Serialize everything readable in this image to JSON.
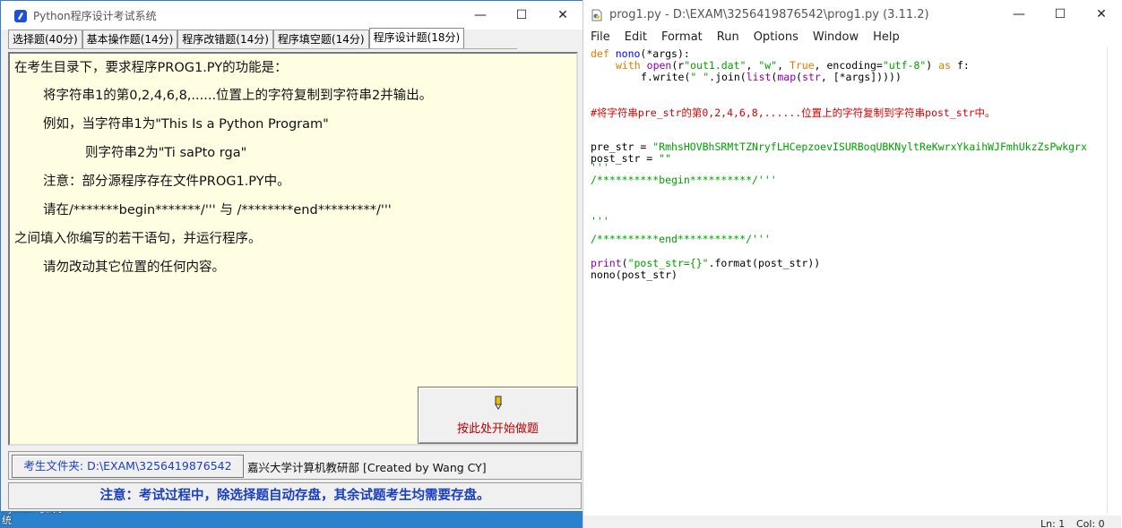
{
  "desktop": {
    "icon_label": "Python考试系统"
  },
  "exam_window": {
    "title": "Python程序设计考试系统",
    "tabs": [
      "选择题(40分)",
      "基本操作题(14分)",
      "程序改错题(14分)",
      "程序填空题(14分)",
      "程序设计题(18分)"
    ],
    "active_tab": 4,
    "content_lines": [
      "在考生目录下，要求程序PROG1.PY的功能是：",
      "将字符串1的第0,2,4,6,8,......位置上的字符复制到字符串2并输出。",
      "例如，当字符串1为\"This Is a Python Program\"",
      "则字符串2为\"Ti saPto rga\"",
      "注意：部分源程序存在文件PROG1.PY中。",
      "请在/*******begin*******/''' 与 /********end*********/'''",
      "之间填入你编写的若干语句，并运行程序。",
      "请勿改动其它位置的任何内容。"
    ],
    "start_button": {
      "icon": "pencil-icon",
      "label": "按此处开始做题"
    },
    "folder_button": "考生文件夹: D:\\EXAM\\3256419876542",
    "credit": "嘉兴大学计算机教研部 [Created by Wang CY]",
    "notice": "注意：考试过程中，除选择题自动存盘，其余试题考生均需要存盘。",
    "window_controls": {
      "minimize": "—",
      "maximize": "☐",
      "close": "✕"
    }
  },
  "idle_window": {
    "title": "prog1.py - D:\\EXAM\\3256419876542\\prog1.py (3.11.2)",
    "menu": [
      "File",
      "Edit",
      "Format",
      "Run",
      "Options",
      "Window",
      "Help"
    ],
    "code": {
      "l1_def": "def",
      "l1_name": "nono",
      "l1_rest": "(*args):",
      "l2_with": "with",
      "l2_open": "open",
      "l2_p1": "(r",
      "l2_s1": "\"out1.dat\"",
      "l2_c1": ", ",
      "l2_s2": "\"w\"",
      "l2_c2": ", ",
      "l2_true": "True",
      "l2_c3": ", encoding=",
      "l2_s3": "\"utf-8\"",
      "l2_c4": ") ",
      "l2_as": "as",
      "l2_f": " f:",
      "l3_a": "f.write(",
      "l3_s": "\" \"",
      "l3_b": ".join(",
      "l3_list": "list",
      "l3_c": "(",
      "l3_map": "map",
      "l3_d": "(",
      "l3_str": "str",
      "l3_e": ", [*args]))))",
      "comment": "#将字符串pre_str的第0,2,4,6,8,......位置上的字符复制到字符串post_str中。",
      "pre_a": "pre_str = ",
      "pre_s": "\"RmhsHOVBhSRMtTZNryfLHCepzoevISURBoqUBKNyltReKwrxYkaihWJFmhUkzZsPwkgrx",
      "post_a": "post_str = ",
      "post_s": "\"\"",
      "q1": "'''",
      "begin": "/**********begin**********/'''",
      "q2": "'''",
      "end": "/**********end***********/'''",
      "p_print": "print",
      "p_a": "(",
      "p_s": "\"post_str={}\"",
      "p_b": ".format(post_str))",
      "nono_call": "nono(post_str)"
    },
    "status": {
      "ln": "Ln: 1",
      "col": "Col: 0"
    },
    "window_controls": {
      "minimize": "—",
      "maximize": "☐",
      "close": "✕"
    }
  },
  "colors": {
    "keyword": "#e07b00",
    "string": "#00a000",
    "builtin": "#8a00a8",
    "comment": "#dd0000",
    "defname": "#0000ff",
    "accent": "#1a3fbf"
  }
}
